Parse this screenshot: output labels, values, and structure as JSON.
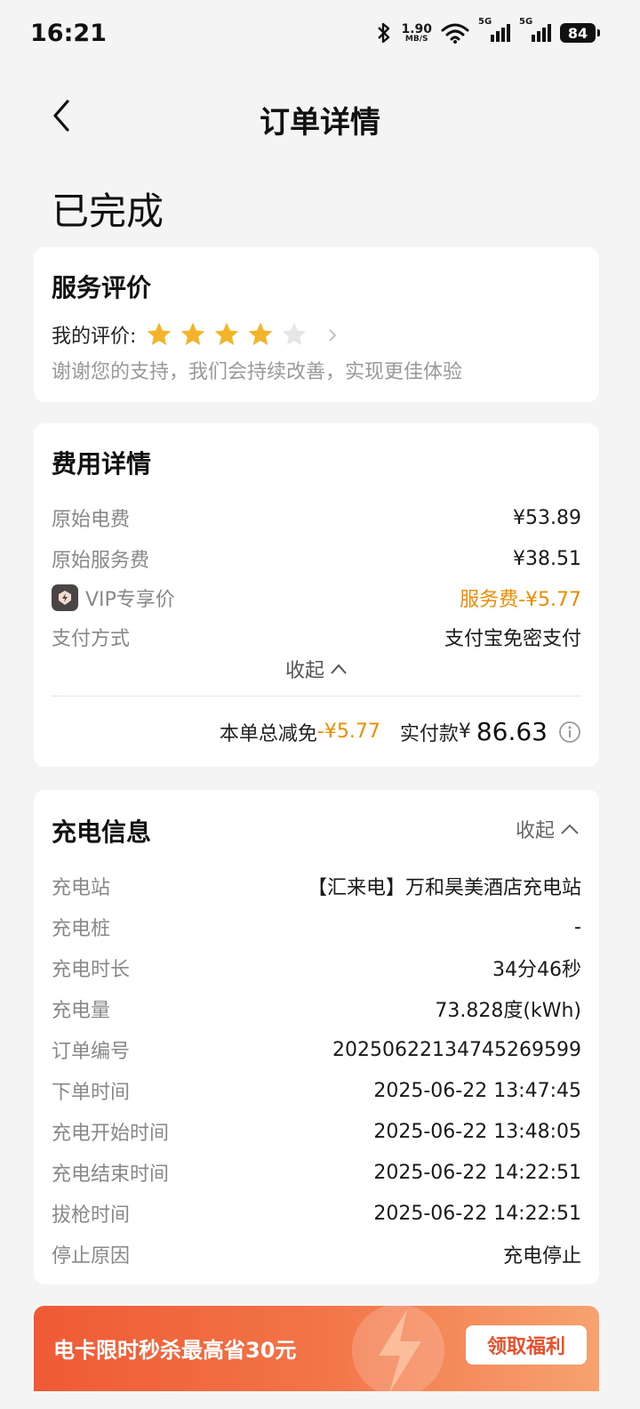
{
  "status_bar": {
    "time": "16:21",
    "net_speed_value": "1.90",
    "net_speed_unit": "MB/S",
    "signal1_label": "5G",
    "signal2_label": "5G",
    "battery": "84"
  },
  "nav": {
    "title": "订单详情"
  },
  "order_status": "已完成",
  "rating": {
    "title": "服务评价",
    "label": "我的评价:",
    "stars": 4,
    "max_stars": 5,
    "note": "谢谢您的支持，我们会持续改善，实现更佳体验"
  },
  "fees": {
    "title": "费用详情",
    "rows": [
      {
        "label": "原始电费",
        "value": "¥53.89"
      },
      {
        "label": "原始服务费",
        "value": "¥38.51"
      },
      {
        "label": "VIP专享价",
        "value": "服务费-¥5.77"
      },
      {
        "label": "支付方式",
        "value": "支付宝免密支付"
      }
    ],
    "collapse_label": "收起",
    "total_discount_label": "本单总减免",
    "total_discount_value": "-¥5.77",
    "paid_label": "实付款",
    "paid_currency": "¥",
    "paid_amount": "86.63"
  },
  "charge_info": {
    "title": "充电信息",
    "collapse_label": "收起",
    "rows": [
      {
        "label": "充电站",
        "value": "【汇来电】万和昊美酒店充电站"
      },
      {
        "label": "充电桩",
        "value": "-"
      },
      {
        "label": "充电时长",
        "value": "34分46秒"
      },
      {
        "label": "充电量",
        "value": "73.828度(kWh)"
      },
      {
        "label": "订单编号",
        "value": "20250622134745269599"
      },
      {
        "label": "下单时间",
        "value": "2025-06-22 13:47:45"
      },
      {
        "label": "充电开始时间",
        "value": "2025-06-22 13:48:05"
      },
      {
        "label": "充电结束时间",
        "value": "2025-06-22 14:22:51"
      },
      {
        "label": "拔枪时间",
        "value": "2025-06-22 14:22:51"
      },
      {
        "label": "停止原因",
        "value": "充电停止"
      }
    ]
  },
  "banner": {
    "text": "电卡限时秒杀最高省30元",
    "button": "领取福利"
  },
  "colors": {
    "accent_orange": "#f08c00",
    "star_gold": "#f4b42a",
    "banner_start": "#ef5a35",
    "banner_end": "#f7a270"
  }
}
